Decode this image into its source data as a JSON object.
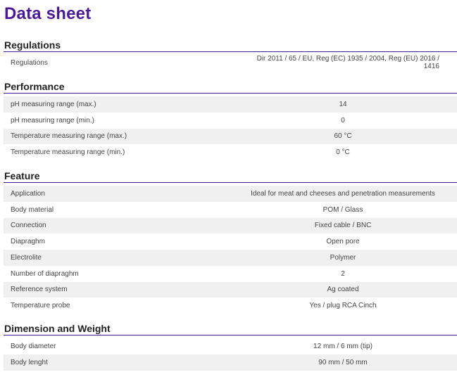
{
  "title": "Data sheet",
  "sections": [
    {
      "name": "Regulations",
      "rows": [
        {
          "label": "Regulations",
          "value": "Dir 2011 / 65 / EU, Reg (EC) 1935 / 2004, Reg (EU) 2016 / 1416"
        }
      ]
    },
    {
      "name": "Performance",
      "rows": [
        {
          "label": "pH measuring range (max.)",
          "value": "14"
        },
        {
          "label": "pH measuring range (min.)",
          "value": "0"
        },
        {
          "label": "Temperature measuring range (max.)",
          "value": "60 °C"
        },
        {
          "label": "Temperature measuring range (min.)",
          "value": "0 °C"
        }
      ]
    },
    {
      "name": "Feature",
      "rows": [
        {
          "label": "Application",
          "value": "Ideal for meat and cheeses and penetration measurements"
        },
        {
          "label": "Body material",
          "value": "POM / Glass"
        },
        {
          "label": "Connection",
          "value": "Fixed cable / BNC"
        },
        {
          "label": "Diapraghm",
          "value": "Open pore"
        },
        {
          "label": "Electrolite",
          "value": "Polymer"
        },
        {
          "label": "Number of diapraghm",
          "value": "2"
        },
        {
          "label": "Reference system",
          "value": "Ag coated"
        },
        {
          "label": "Temperature probe",
          "value": "Yes / plug RCA Cinch"
        }
      ]
    },
    {
      "name": "Dimension and Weight",
      "rows": [
        {
          "label": "Body diameter",
          "value": "12 mm / 6 mm (tip)"
        },
        {
          "label": "Body lenght",
          "value": "90 mm / 50 mm"
        }
      ]
    }
  ]
}
